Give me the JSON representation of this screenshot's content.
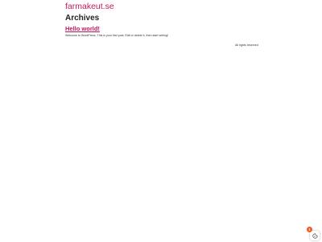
{
  "header": {
    "site_title": "farmakeut.se"
  },
  "main": {
    "archive_title": "Archives",
    "posts": [
      {
        "title": "Hello world!",
        "excerpt": "Welcome to WordPress. This is your first post. Edit or delete it, then start writing!"
      }
    ]
  },
  "footer": {
    "copyright": "All rights reserved"
  },
  "cookie_widget": {
    "badge_count": "1",
    "icon": "cookie-icon",
    "badge_color": "#f05a24"
  },
  "colors": {
    "accent": "#c2185b",
    "text": "#222222",
    "background": "#ffffff"
  }
}
